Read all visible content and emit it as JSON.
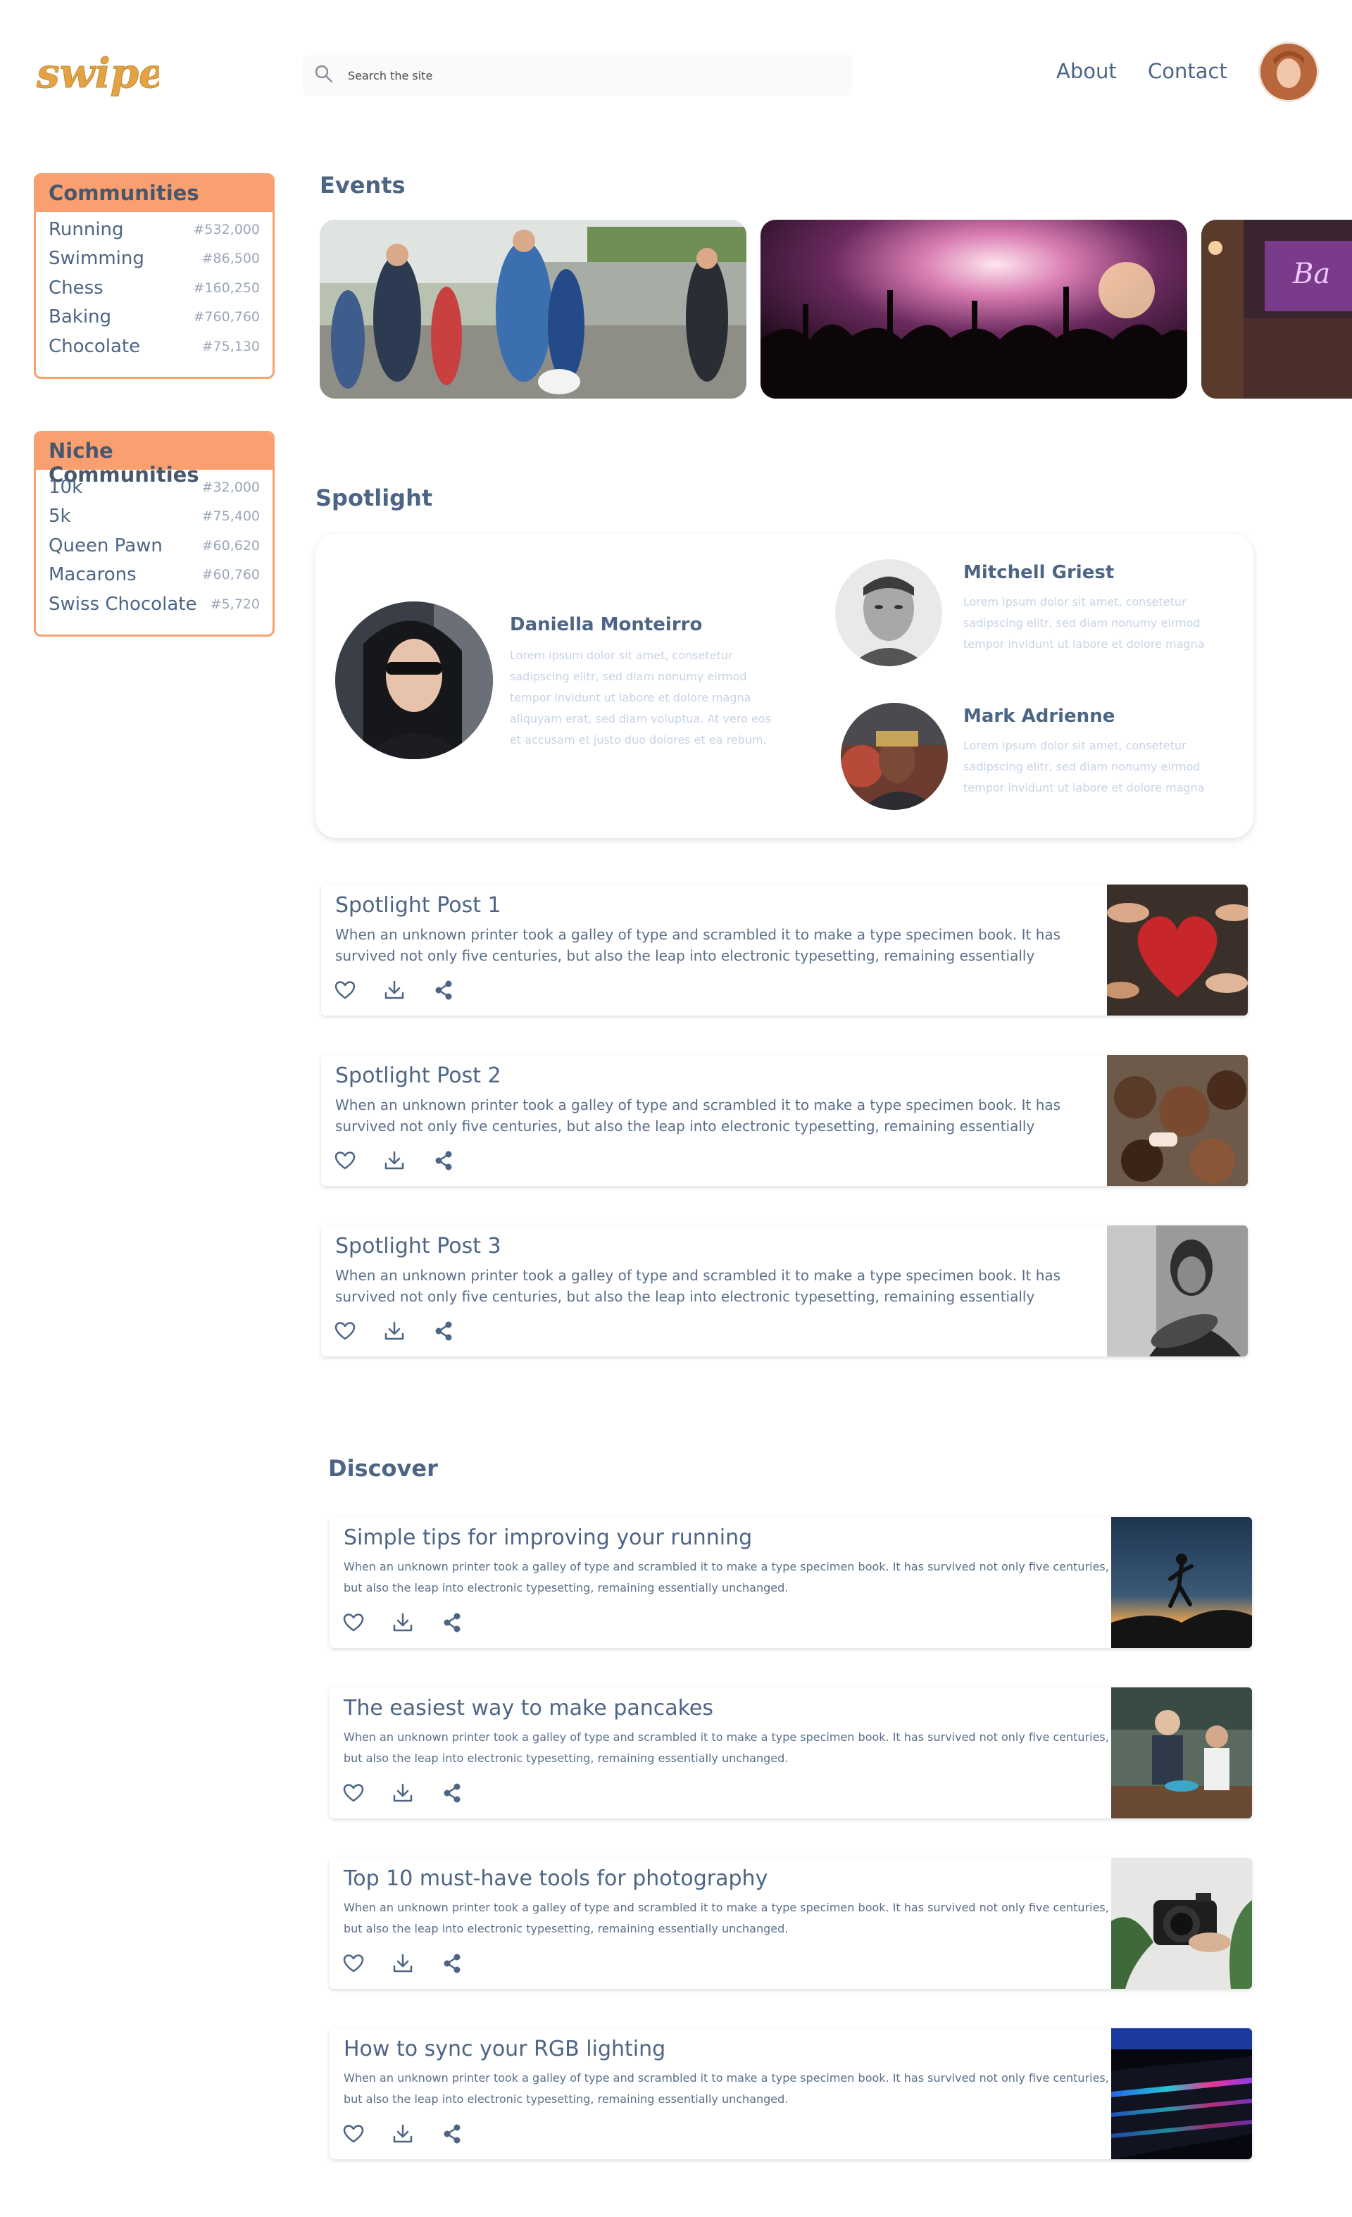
{
  "header": {
    "logo_text": "swipe",
    "search_placeholder": "Search the site",
    "nav": [
      "About",
      "Contact"
    ]
  },
  "sidebar": {
    "communities": {
      "title": "Communities",
      "items": [
        {
          "label": "Running",
          "count": "#532,000"
        },
        {
          "label": "Swimming",
          "count": "#86,500"
        },
        {
          "label": "Chess",
          "count": "#160,250"
        },
        {
          "label": "Baking",
          "count": "#760,760"
        },
        {
          "label": "Chocolate",
          "count": "#75,130"
        }
      ]
    },
    "niche": {
      "title": "Niche Communities",
      "items": [
        {
          "label": "10k",
          "count": "#32,000"
        },
        {
          "label": "5k",
          "count": "#75,400"
        },
        {
          "label": "Queen Pawn",
          "count": "#60,620"
        },
        {
          "label": "Macarons",
          "count": "#60,760"
        },
        {
          "label": "Swiss Chocolate",
          "count": "#5,720"
        }
      ]
    }
  },
  "events": {
    "title": "Events"
  },
  "spotlight": {
    "title": "Spotlight",
    "people": [
      {
        "name": "Daniella Monteirro",
        "desc_lines": [
          "Lorem ipsum dolor sit amet, consetetur",
          "sadipscing elitr, sed diam nonumy eirmod",
          "tempor invidunt ut labore et dolore magna",
          "aliquyam erat, sed diam voluptua. At vero eos",
          "et accusam et justo duo dolores et ea rebum."
        ]
      },
      {
        "name": "Mitchell Griest",
        "desc_lines": [
          "Lorem ipsum dolor sit amet, consetetur",
          "sadipscing elitr, sed diam nonumy eirmod",
          "tempor invidunt ut labore et dolore magna"
        ]
      },
      {
        "name": "Mark Adrienne",
        "desc_lines": [
          "Lorem ipsum dolor sit amet, consetetur",
          "sadipscing elitr, sed diam nonumy eirmod",
          "tempor invidunt ut labore et dolore magna"
        ]
      }
    ],
    "posts": [
      {
        "title": "Spotlight Post 1",
        "desc_lines": [
          "When an unknown printer took a galley of type and scrambled it to make a type specimen book. It has",
          "survived not only five centuries, but also the leap into electronic typesetting, remaining essentially"
        ]
      },
      {
        "title": "Spotlight Post 2",
        "desc_lines": [
          "When an unknown printer took a galley of type and scrambled it to make a type specimen book. It has",
          "survived not only five centuries, but also the leap into electronic typesetting, remaining essentially"
        ]
      },
      {
        "title": "Spotlight Post 3",
        "desc_lines": [
          "When an unknown printer took a galley of type and scrambled it to make a type specimen book. It has",
          "survived not only five centuries, but also the leap into electronic typesetting, remaining essentially"
        ]
      }
    ]
  },
  "discover": {
    "title": "Discover",
    "posts": [
      {
        "title": "Simple tips for improving your running",
        "desc_lines": [
          "When an unknown printer took a galley of type and scrambled it to make a type specimen book. It has survived not only five centuries,",
          "but also the leap into electronic typesetting, remaining essentially unchanged."
        ]
      },
      {
        "title": "The easiest way to make pancakes",
        "desc_lines": [
          "When an unknown printer took a galley of type and scrambled it to make a type specimen book. It has survived not only five centuries,",
          "but also the leap into electronic typesetting, remaining essentially unchanged."
        ]
      },
      {
        "title": "Top 10 must-have tools for photography",
        "desc_lines": [
          "When an unknown printer took a galley of type and scrambled it to make a type specimen book. It has survived not only five centuries,",
          "but also the leap into electronic typesetting, remaining essentially unchanged."
        ]
      },
      {
        "title": "How to sync your RGB lighting",
        "desc_lines": [
          "When an unknown printer took a galley of type and scrambled it to make a type specimen book. It has survived not only five centuries,",
          "but also the leap into electronic typesetting, remaining essentially unchanged."
        ]
      }
    ]
  },
  "colors": {
    "accent": "#fa9f6f",
    "text": "#4d6585",
    "muted": "#c7d3e5",
    "logo": "#e0a040"
  },
  "icons": [
    "search-icon",
    "heart-icon",
    "download-icon",
    "share-icon"
  ]
}
